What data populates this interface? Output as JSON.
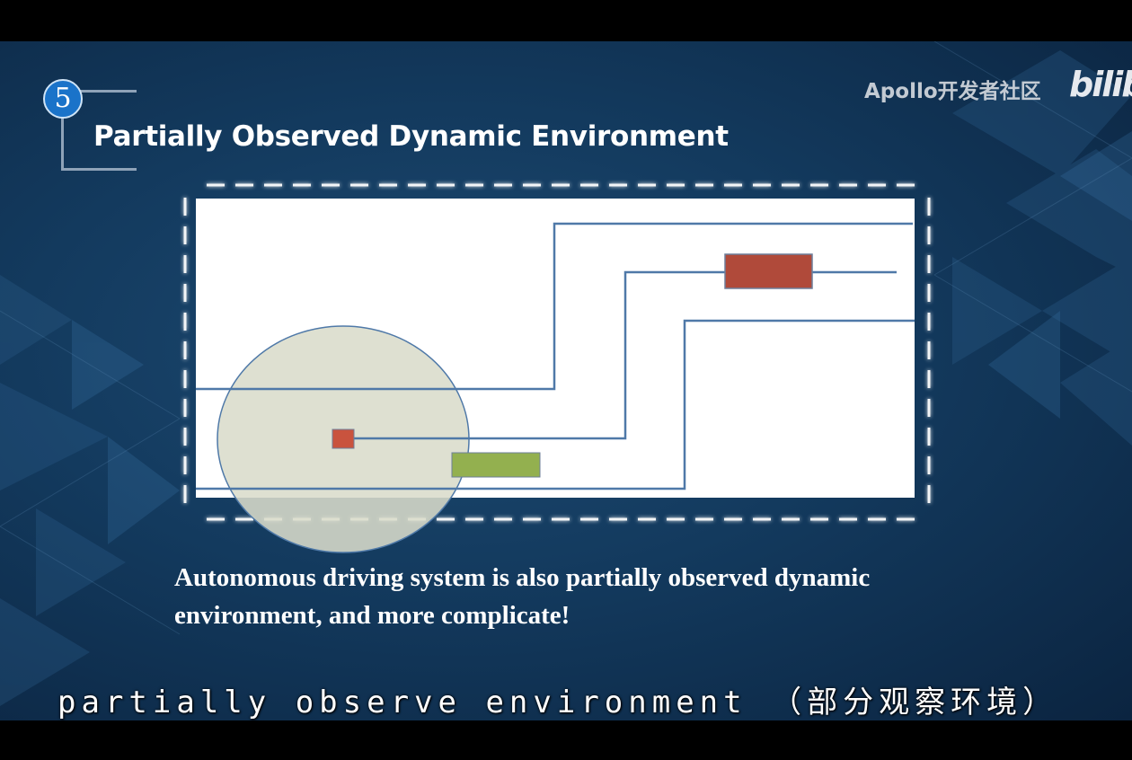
{
  "slide": {
    "number": "5",
    "title": "Partially Observed Dynamic Environment",
    "caption": "Autonomous driving system is also partially observed dynamic environment, and more complicate!"
  },
  "watermark": {
    "channel": "Apollo开发者社区",
    "platform_logo": "bilib"
  },
  "subtitle": "partially observe environment （部分观察环境）",
  "colors": {
    "background": "#133a5e",
    "badge": "#1a73c9",
    "dashed_frame": "#ffffff",
    "lane_lines": "#4f79a8",
    "sensor_range": "#d9dccb",
    "obstacle_red": "#b04a3a",
    "ego_vehicle": "#c9533e",
    "obstacle_green": "#93b04f"
  }
}
